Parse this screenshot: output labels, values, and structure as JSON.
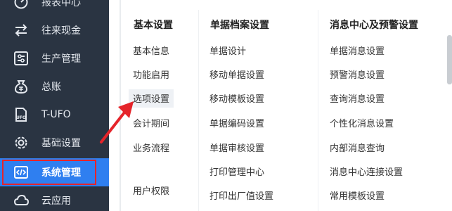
{
  "sidebar": {
    "items": [
      {
        "label": "报表中心",
        "icon": "gauge-icon"
      },
      {
        "label": "往来现金",
        "icon": "exchange-arrows-icon"
      },
      {
        "label": "生产管理",
        "icon": "sliders-icon"
      },
      {
        "label": "总账",
        "icon": "ledger-bag-icon"
      },
      {
        "label": "T-UFO",
        "icon": "ufo-file-icon"
      },
      {
        "label": "基础设置",
        "icon": "gear-icon"
      },
      {
        "label": "系统管理",
        "icon": "code-window-icon",
        "active": true
      },
      {
        "label": "云应用",
        "icon": "cloud-icon"
      }
    ]
  },
  "menu": {
    "columns": [
      {
        "header": "基本设置",
        "links": [
          "基本信息",
          "功能启用",
          "选项设置",
          "会计期间",
          "业务流程",
          "用户权限"
        ]
      },
      {
        "header": "单据档案设置",
        "links": [
          "单据设计",
          "移动单据设置",
          "移动模板设置",
          "单据编码设置",
          "单据审核设置",
          "打印管理中心",
          "打印出厂值设置"
        ]
      },
      {
        "header": "消息中心及预警设置",
        "links": [
          "单据消息设置",
          "预警消息设置",
          "查询消息设置",
          "个性化消息设置",
          "内部消息查询",
          "消息中心连接设置",
          "常用模板设置"
        ]
      }
    ]
  },
  "colors": {
    "sidebar_bg": "#2a3442",
    "active_bg": "#2f7ff0",
    "annotation_red": "#e5242a"
  }
}
